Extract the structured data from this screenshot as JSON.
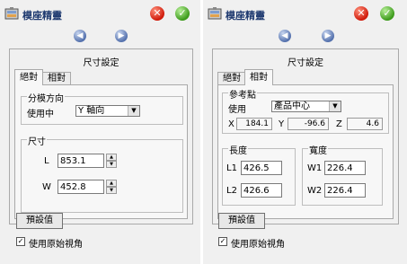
{
  "colors": {
    "title": "#1f3a70",
    "close": "#d01a0a",
    "ok": "#3c9a1a",
    "nav": "#5471ad"
  },
  "left": {
    "title": "模座精靈",
    "icons": {
      "app": "mold-base-icon",
      "close": "close-icon",
      "ok": "check-icon",
      "back": "arrow-left-icon",
      "forward": "arrow-right-icon"
    },
    "frame_title": "尺寸設定",
    "tabs": [
      "絕對",
      "相對"
    ],
    "active_tab": 0,
    "split_group": {
      "title": "分模方向",
      "label": "使用中",
      "value": "Y 軸向"
    },
    "size_group": {
      "title": "尺寸",
      "l_label": "L",
      "l_value": "853.1",
      "w_label": "W",
      "w_value": "452.8"
    },
    "default_button": "預設值",
    "original_view": {
      "label": "使用原始視角",
      "checked": true,
      "mark": "✓"
    }
  },
  "right": {
    "title": "模座精靈",
    "frame_title": "尺寸設定",
    "tabs": [
      "絕對",
      "相對"
    ],
    "active_tab": 1,
    "reference_group": {
      "title": "參考點",
      "label": "使用",
      "value": "產品中心",
      "x_label": "X",
      "x_value": "184.1",
      "y_label": "Y",
      "y_value": "-96.6",
      "z_label": "Z",
      "z_value": "4.6"
    },
    "length_group": {
      "title": "長度",
      "l1_label": "L1",
      "l1_value": "426.5",
      "l2_label": "L2",
      "l2_value": "426.6"
    },
    "width_group": {
      "title": "寬度",
      "w1_label": "W1",
      "w1_value": "226.4",
      "w2_label": "W2",
      "w2_value": "226.4"
    },
    "default_button": "預設值",
    "original_view": {
      "label": "使用原始視角",
      "checked": true,
      "mark": "✓"
    }
  },
  "glyphs": {
    "close": "✕",
    "ok": "✓",
    "back": "◀",
    "forward": "▶",
    "dropdown": "▼",
    "up": "▲",
    "down": "▼"
  }
}
